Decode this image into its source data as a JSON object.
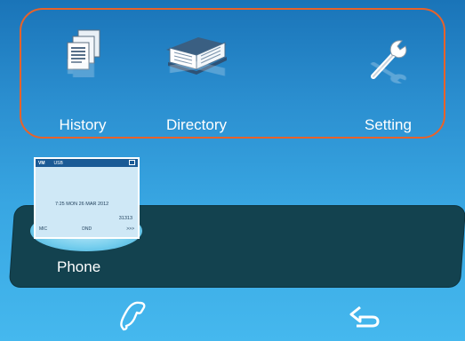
{
  "apps": [
    {
      "name": "history",
      "label": "History",
      "icon": "history-icon"
    },
    {
      "name": "directory",
      "label": "Directory",
      "icon": "book-icon"
    },
    {
      "name": "setting",
      "label": "Setting",
      "icon": "wrench-icon"
    }
  ],
  "phone": {
    "label": "Phone",
    "screen": {
      "status_vm": "VM",
      "status_usb": "USB",
      "datetime": "7:25  MON  26  MAR  2012",
      "extension": "31313",
      "softkeys": [
        "MIC",
        "DND",
        ">>>"
      ]
    }
  },
  "bottom_bar": {
    "left_icon": "handset-icon",
    "right_icon": "back-arrow-icon"
  },
  "colors": {
    "background_top": "#1a74b8",
    "background_bottom": "#45b8ee",
    "frame_border": "#e8622a",
    "phone_panel": "#13424f"
  }
}
